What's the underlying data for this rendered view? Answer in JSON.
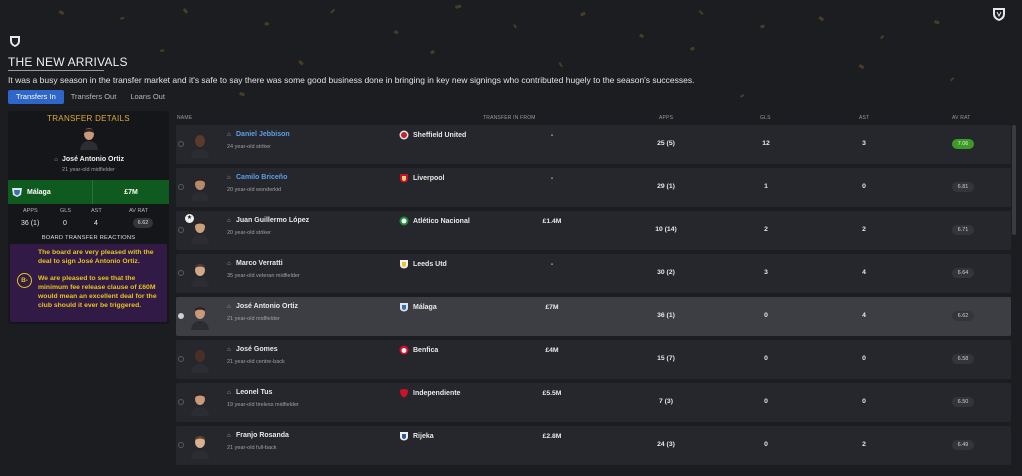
{
  "page": {
    "title": "THE NEW ARRIVALS",
    "subtitle": "It was a busy season in the transfer market and it's safe to say there was some good business done in bringing in key new signings who contributed hugely to the season's successes."
  },
  "tabs": [
    {
      "label": "Transfers In",
      "active": true
    },
    {
      "label": "Transfers Out",
      "active": false
    },
    {
      "label": "Loans Out",
      "active": false
    }
  ],
  "details": {
    "title": "TRANSFER DETAILS",
    "player_name": "José Antonio Ortiz",
    "player_desc": "21 year-old midfielder",
    "club": "Málaga",
    "fee": "£7M",
    "stat_labels": {
      "apps": "APPS",
      "gls": "GLS",
      "ast": "AST",
      "rat": "AV RAT"
    },
    "stats": {
      "apps": "36 (1)",
      "gls": "0",
      "ast": "4",
      "rat": "6.62"
    },
    "reactions_title": "BOARD TRANSFER REACTIONS",
    "grade": "B-",
    "reaction_1": "The board are very pleased with the deal to sign José Antonio Ortiz.",
    "reaction_2": "We are pleased to see that the minimum fee release clause of £60M would mean an excellent deal for the club should it ever be triggered."
  },
  "columns": {
    "name": "NAME",
    "from": "TRANSFER IN FROM",
    "apps": "APPS",
    "gls": "GLS",
    "ast": "AST",
    "rat": "AV RAT"
  },
  "rows": [
    {
      "name": "Daniel Jebbison",
      "desc": "24 year-old striker",
      "from": "Sheffield United",
      "fee": "-",
      "apps": "25 (5)",
      "gls": "12",
      "ast": "3",
      "rat": "7.06"
    },
    {
      "name": "Camilo Briceño",
      "desc": "20 year-old wonderkid",
      "from": "Liverpool",
      "fee": "-",
      "apps": "29 (1)",
      "gls": "1",
      "ast": "0",
      "rat": "6.81"
    },
    {
      "name": "Juan Guillermo López",
      "desc": "20 year-old striker",
      "from": "Atlético Nacional",
      "fee": "£1.4M",
      "apps": "10 (14)",
      "gls": "2",
      "ast": "2",
      "rat": "6.71"
    },
    {
      "name": "Marco Verratti",
      "desc": "35 year-old veteran midfielder",
      "from": "Leeds Utd",
      "fee": "-",
      "apps": "30 (2)",
      "gls": "3",
      "ast": "4",
      "rat": "6.64"
    },
    {
      "name": "José Antonio Ortiz",
      "desc": "21 year-old midfielder",
      "from": "Málaga",
      "fee": "£7M",
      "apps": "36 (1)",
      "gls": "0",
      "ast": "4",
      "rat": "6.62"
    },
    {
      "name": "José Gomes",
      "desc": "21 year-old centre-back",
      "from": "Benfica",
      "fee": "£4M",
      "apps": "15 (7)",
      "gls": "0",
      "ast": "0",
      "rat": "6.58"
    },
    {
      "name": "Leonel Tus",
      "desc": "19 year-old tireless midfielder",
      "from": "Independiente",
      "fee": "£5.5M",
      "apps": "7 (3)",
      "gls": "0",
      "ast": "0",
      "rat": "6.50"
    },
    {
      "name": "Franjo Rosanda",
      "desc": "21 year-old full-back",
      "from": "Rijeka",
      "fee": "£2.8M",
      "apps": "24 (3)",
      "gls": "0",
      "ast": "2",
      "rat": "6.49"
    }
  ]
}
